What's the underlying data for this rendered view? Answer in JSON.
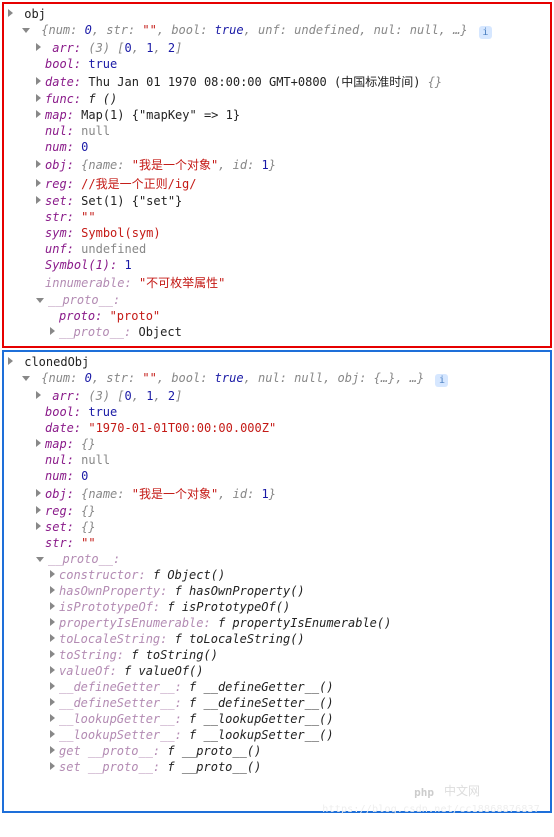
{
  "obj": {
    "title": "obj",
    "summary_parts": [
      {
        "k": "num",
        "v": "0",
        "cls": "num"
      },
      {
        "k": "str",
        "v": "\"\"",
        "cls": "str"
      },
      {
        "k": "bool",
        "v": "true",
        "cls": "bool"
      },
      {
        "k": "unf",
        "v": "undefined",
        "cls": "undef"
      },
      {
        "k": "nul",
        "v": "null",
        "cls": "nul"
      },
      {
        "k": null,
        "v": "…",
        "cls": "preview"
      }
    ],
    "arr": {
      "label": "arr",
      "len": "(3)",
      "items": [
        "0",
        "1",
        "2"
      ]
    },
    "bool": {
      "k": "bool",
      "v": "true"
    },
    "date": {
      "k": "date",
      "v": "Thu Jan 01 1970 08:00:00 GMT+0800 (中国标准时间)",
      "suffix": "{}"
    },
    "func": {
      "k": "func",
      "v": "f ()"
    },
    "map": {
      "k": "map",
      "v": "Map(1) {\"mapKey\" => 1}"
    },
    "nul": {
      "k": "nul",
      "v": "null"
    },
    "num": {
      "k": "num",
      "v": "0"
    },
    "inner_obj": {
      "k": "obj",
      "name": "\"我是一个对象\"",
      "id": "1"
    },
    "reg": {
      "k": "reg",
      "v": "//我是一个正则/ig/"
    },
    "set": {
      "k": "set",
      "v": "Set(1) {\"set\"}"
    },
    "str": {
      "k": "str",
      "v": "\"\""
    },
    "sym": {
      "k": "sym",
      "v": "Symbol(sym)"
    },
    "unf": {
      "k": "unf",
      "v": "undefined"
    },
    "symKey": {
      "k": "Symbol(1)",
      "v": "1"
    },
    "innum": {
      "k": "innumerable",
      "v": "\"不可枚举属性\""
    },
    "proto": {
      "k": "__proto__",
      "child_k": "proto",
      "child_v": "\"proto\"",
      "proto2_k": "__proto__",
      "proto2_v": "Object"
    }
  },
  "cloned": {
    "title": "clonedObj",
    "summary_parts": [
      {
        "k": "num",
        "v": "0",
        "cls": "num"
      },
      {
        "k": "str",
        "v": "\"\"",
        "cls": "str"
      },
      {
        "k": "bool",
        "v": "true",
        "cls": "bool"
      },
      {
        "k": "nul",
        "v": "null",
        "cls": "nul"
      },
      {
        "k": "obj",
        "v": "{…}",
        "cls": "preview"
      },
      {
        "k": null,
        "v": "…",
        "cls": "preview"
      }
    ],
    "arr": {
      "label": "arr",
      "len": "(3)",
      "items": [
        "0",
        "1",
        "2"
      ]
    },
    "bool": {
      "k": "bool",
      "v": "true"
    },
    "date": {
      "k": "date",
      "v": "\"1970-01-01T00:00:00.000Z\""
    },
    "map": {
      "k": "map",
      "v": "{}"
    },
    "nul": {
      "k": "nul",
      "v": "null"
    },
    "num": {
      "k": "num",
      "v": "0"
    },
    "inner_obj": {
      "k": "obj",
      "name": "\"我是一个对象\"",
      "id": "1"
    },
    "reg": {
      "k": "reg",
      "v": "{}"
    },
    "set": {
      "k": "set",
      "v": "{}"
    },
    "str": {
      "k": "str",
      "v": "\"\""
    },
    "proto_label": "__proto__",
    "proto_items": [
      {
        "k": "constructor",
        "v": "f Object()"
      },
      {
        "k": "hasOwnProperty",
        "v": "f hasOwnProperty()"
      },
      {
        "k": "isPrototypeOf",
        "v": "f isPrototypeOf()"
      },
      {
        "k": "propertyIsEnumerable",
        "v": "f propertyIsEnumerable()"
      },
      {
        "k": "toLocaleString",
        "v": "f toLocaleString()"
      },
      {
        "k": "toString",
        "v": "f toString()"
      },
      {
        "k": "valueOf",
        "v": "f valueOf()"
      },
      {
        "k": "__defineGetter__",
        "v": "f __defineGetter__()"
      },
      {
        "k": "__defineSetter__",
        "v": "f __defineSetter__()"
      },
      {
        "k": "__lookupGetter__",
        "v": "f __lookupGetter__()"
      },
      {
        "k": "__lookupSetter__",
        "v": "f __lookupSetter__()"
      },
      {
        "k": "get __proto__",
        "v": "f __proto__()"
      },
      {
        "k": "set __proto__",
        "v": "f __proto__()"
      }
    ]
  },
  "watermark": {
    "logo": "php",
    "cn": "中文网",
    "url": "https://blog.csdn.net/cc18868876837"
  }
}
